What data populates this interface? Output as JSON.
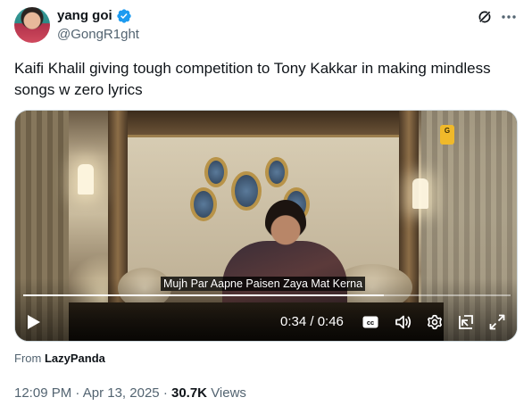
{
  "author": {
    "display_name": "yang goi",
    "handle": "@GongR1ght",
    "verified": true
  },
  "colors": {
    "verified_blue": "#1d9bf0",
    "text_primary": "#0f1419",
    "text_secondary": "#536471"
  },
  "tweet": {
    "text": "Kaifi Khalil giving tough competition to Tony Kakkar in making mindless songs w zero lyrics"
  },
  "video": {
    "caption": "Mujh Par Aapne Paisen Zaya Mat Kerna",
    "time_display": "0:34 / 0:46",
    "progress_fraction": 0.74,
    "controls": [
      "play-icon",
      "cc-icon",
      "volume-icon",
      "gear-icon",
      "pip-icon",
      "fullscreen-icon"
    ]
  },
  "source": {
    "prefix": "From",
    "name": "LazyPanda"
  },
  "meta": {
    "time": "12:09 PM",
    "separator": "·",
    "date": "Apr 13, 2025",
    "views_count": "30.7K",
    "views_label": "Views"
  }
}
